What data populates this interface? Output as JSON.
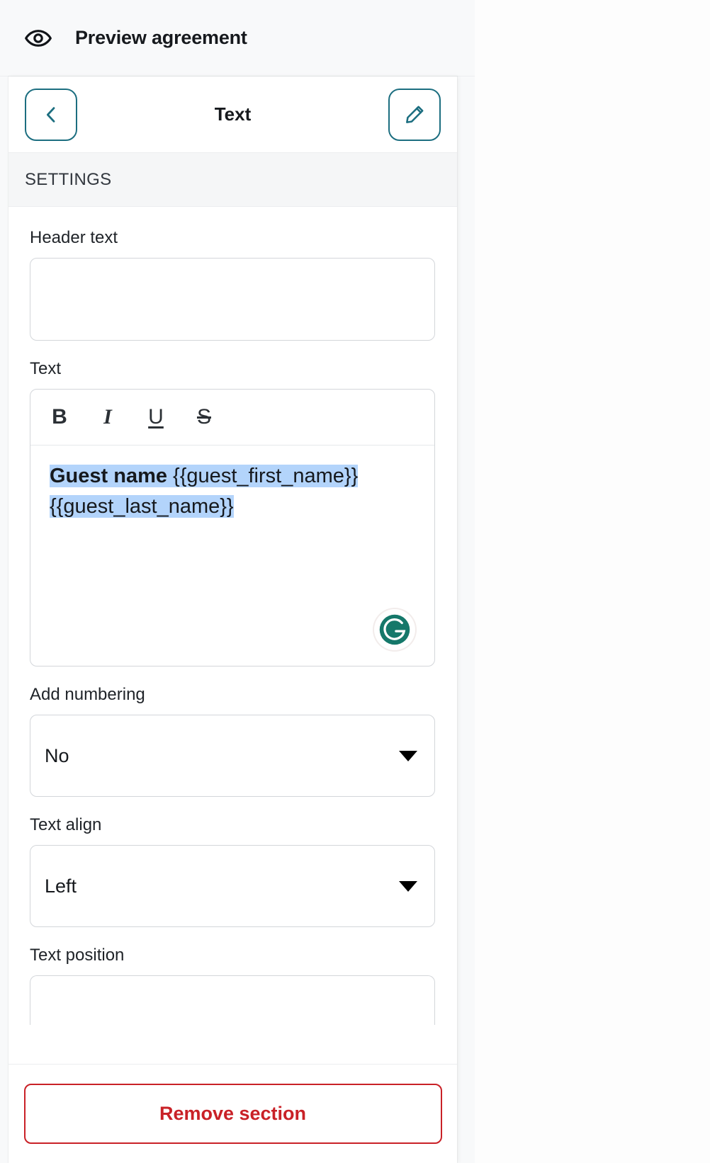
{
  "preview": {
    "icon": "eye-icon",
    "label": "Preview agreement"
  },
  "panel": {
    "back_icon": "chevron-left-icon",
    "title": "Text",
    "edit_icon": "pencil-icon",
    "section_label": "SETTINGS"
  },
  "fields": {
    "header_text": {
      "label": "Header text",
      "value": "",
      "placeholder": ""
    },
    "text": {
      "label": "Text",
      "toolbar": [
        {
          "name": "bold-button",
          "glyph": "B"
        },
        {
          "name": "italic-button",
          "glyph": "I"
        },
        {
          "name": "underline-button",
          "glyph": "U"
        },
        {
          "name": "strikethrough-button",
          "glyph": "S"
        }
      ],
      "content_bold": "Guest name",
      "content_rest": " {{guest_first_name}} {{guest_last_name}}",
      "selection_highlight_color": "#b3d4fb",
      "assistant_icon": "grammarly-icon"
    },
    "add_numbering": {
      "label": "Add numbering",
      "value": "No"
    },
    "text_align": {
      "label": "Text align",
      "value": "Left"
    },
    "text_position": {
      "label": "Text position",
      "value": ""
    }
  },
  "footer": {
    "remove_label": "Remove section",
    "remove_color": "#c92127"
  }
}
